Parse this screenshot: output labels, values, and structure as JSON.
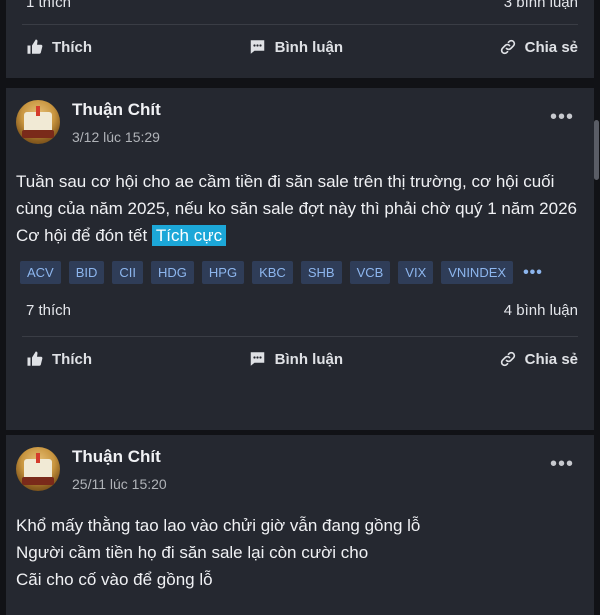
{
  "prev_post": {
    "likes": "1 thích",
    "comments": "3 bình luận",
    "actions": {
      "like": "Thích",
      "comment": "Bình luận",
      "share": "Chia sẻ"
    }
  },
  "post1": {
    "author": "Thuận Chít",
    "time": "3/12 lúc 15:29",
    "content_line1": "Tuần sau cơ hội cho ae cầm tiền đi săn sale trên thị trường, cơ hội cuối cùng của năm 2025, nếu ko săn sale đợt này thì phải chờ quý 1 năm 2026",
    "content_line2": "Cơ hội để đón tết",
    "sentiment": "Tích cực",
    "tags": [
      "ACV",
      "BID",
      "CII",
      "HDG",
      "HPG",
      "KBC",
      "SHB",
      "VCB",
      "VIX",
      "VNINDEX"
    ],
    "likes": "7 thích",
    "comments": "4 bình luận",
    "actions": {
      "like": "Thích",
      "comment": "Bình luận",
      "share": "Chia sẻ"
    }
  },
  "post2": {
    "author": "Thuận Chít",
    "time": "25/11 lúc 15:20",
    "line1": "Khổ mấy thằng tao lao vào chửi giờ vẫn đang gồng lỗ",
    "line2": "Người cầm tiền họ đi săn sale lại còn cười cho",
    "line3": "Cãi cho cố vào để gồng lỗ"
  }
}
